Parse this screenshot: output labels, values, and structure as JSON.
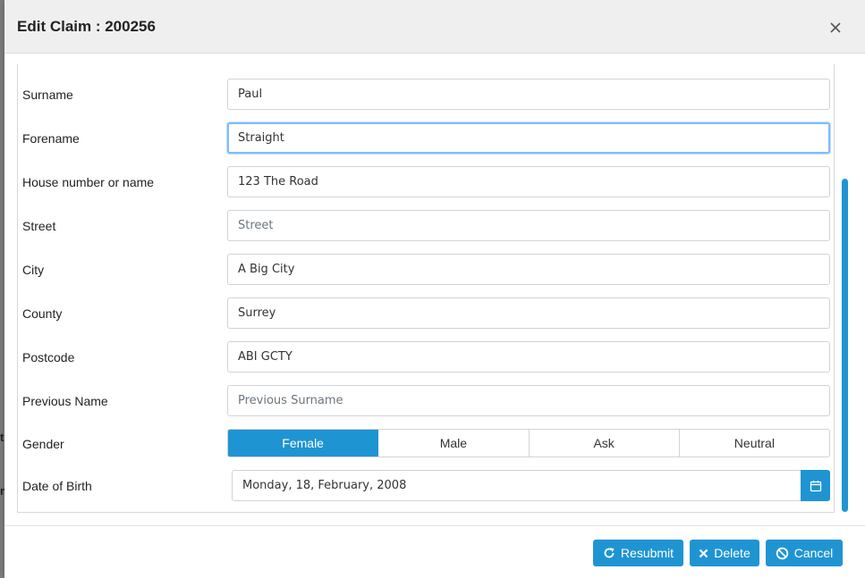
{
  "modal": {
    "title": "Edit Claim : 200256",
    "close_icon": "close-icon"
  },
  "background": {
    "glyphs": [
      "t",
      "m"
    ]
  },
  "form": {
    "fields": [
      {
        "label": "Surname",
        "value": "Paul",
        "placeholder": ""
      },
      {
        "label": "Forename",
        "value": "Straight",
        "placeholder": ""
      },
      {
        "label": "House number or name",
        "value": "123 The Road",
        "placeholder": ""
      },
      {
        "label": "Street",
        "value": "",
        "placeholder": "Street"
      },
      {
        "label": "City",
        "value": "A Big City",
        "placeholder": ""
      },
      {
        "label": "County",
        "value": "Surrey",
        "placeholder": ""
      },
      {
        "label": "Postcode",
        "value": "ABI GCTY",
        "placeholder": ""
      },
      {
        "label": "Previous Name",
        "value": "",
        "placeholder": "Previous Surname"
      }
    ],
    "gender": {
      "label": "Gender",
      "options": [
        "Female",
        "Male",
        "Ask",
        "Neutral"
      ],
      "selected": "Female"
    },
    "dob": {
      "label": "Date of Birth",
      "value": "Monday, 18, February, 2008",
      "icon": "calendar-icon"
    }
  },
  "footer": {
    "resubmit_label": "Resubmit",
    "delete_label": "Delete",
    "cancel_label": "Cancel"
  },
  "colors": {
    "accent": "#1f94d2",
    "focus_border": "#80bdff"
  }
}
